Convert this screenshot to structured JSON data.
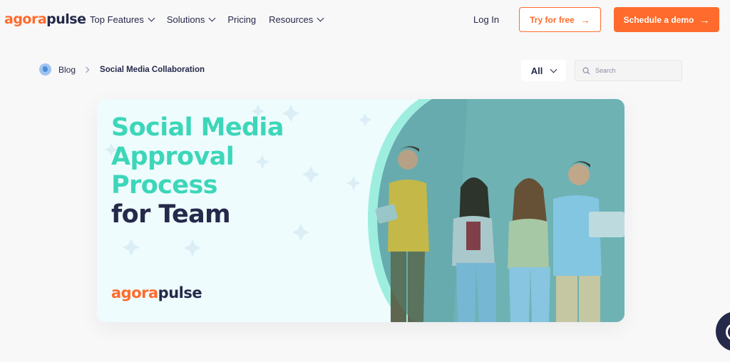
{
  "nav": {
    "logo_a": "agora",
    "logo_b": "pulse",
    "menu": [
      {
        "label": "Top Features"
      },
      {
        "label": "Solutions"
      },
      {
        "label": "Pricing"
      },
      {
        "label": "Resources"
      }
    ],
    "login": "Log In",
    "try_label": "Try for free",
    "demo_label": "Schedule a demo"
  },
  "breadcrumb": {
    "blog": "Blog",
    "current": "Social Media Collaboration"
  },
  "filter": {
    "value": "All"
  },
  "search": {
    "placeholder": "Search"
  },
  "hero": {
    "title_line1": "Social Media",
    "title_line2": "Approval",
    "title_line3": "Process",
    "title_line4": "for Team",
    "logo_a": "agora",
    "logo_b": "pulse"
  },
  "colors": {
    "brand_orange": "#ff6b2c",
    "navy": "#25294a",
    "teal": "#3dd6b9",
    "hero_bg": "#eefcfe"
  }
}
